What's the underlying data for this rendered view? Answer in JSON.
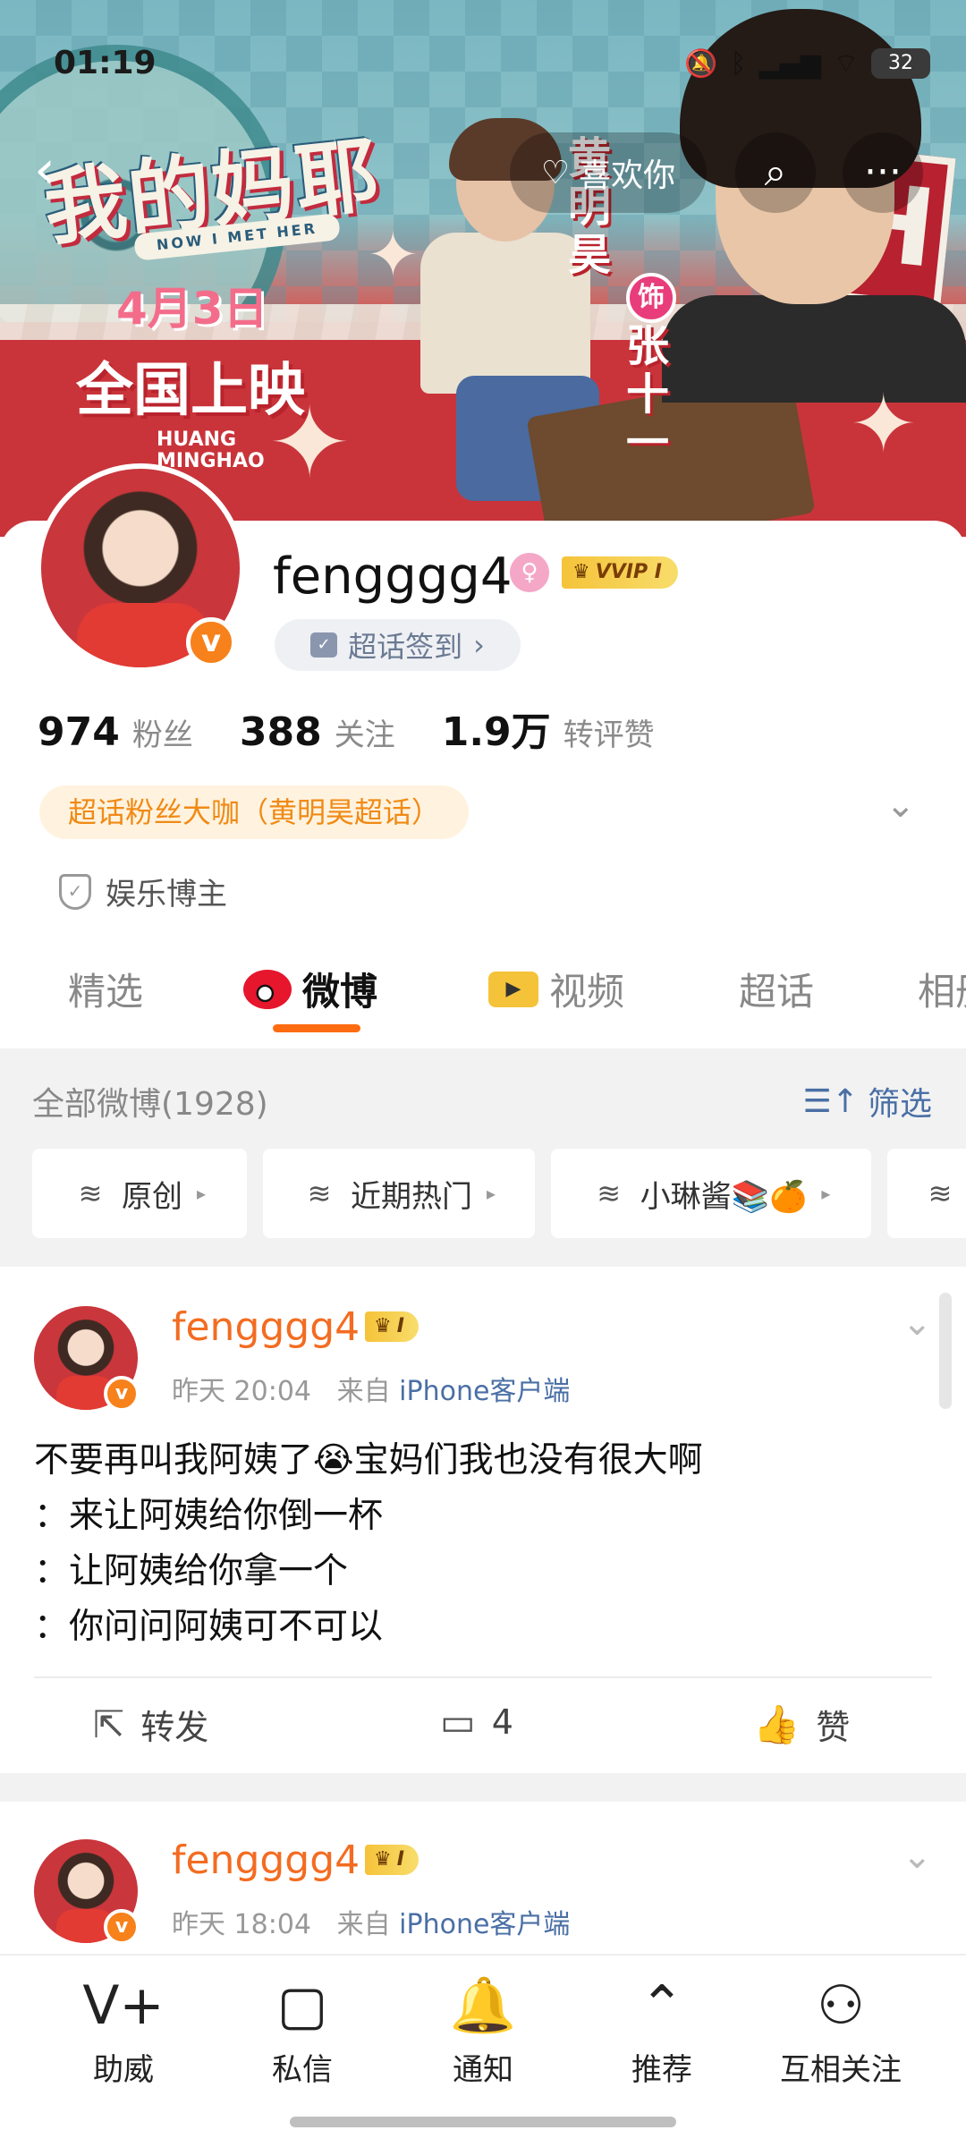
{
  "status_bar": {
    "time": "01:19",
    "battery": "32",
    "icons": [
      "mute-icon",
      "bluetooth-icon",
      "signal-icon",
      "wifi-icon"
    ]
  },
  "banner": {
    "movie_title": "我的妈耶",
    "movie_subtitle": "NOW I MET HER",
    "movie_date": "4月3日",
    "movie_release": "全国上映",
    "actor_name_en_line1": "HUANG",
    "actor_name_en_line2": "MINGHAO",
    "role_actor": "黄明昊",
    "role_badge": "饰",
    "role_character": "张十一",
    "sign_letter": "H"
  },
  "top_nav": {
    "like_label": "喜欢你",
    "icons": [
      "back-icon",
      "search-icon",
      "more-icon"
    ]
  },
  "profile": {
    "username": "fengggg4",
    "vip_label": "VVIP I",
    "checkin_label": "超话签到",
    "stats": [
      {
        "value": "974",
        "label": "粉丝"
      },
      {
        "value": "388",
        "label": "关注"
      },
      {
        "value": "1.9万",
        "label": "转评赞"
      }
    ],
    "fan_badge": "超话粉丝大咖（黄明昊超话）",
    "blogger_tag": "娱乐博主"
  },
  "tabs": [
    {
      "label": "精选",
      "active": false
    },
    {
      "label": "微博",
      "active": true
    },
    {
      "label": "视频",
      "active": false
    },
    {
      "label": "超话",
      "active": false
    },
    {
      "label": "相册",
      "active": false
    }
  ],
  "feed": {
    "title": "全部微博(1928)",
    "filter_label": "筛选",
    "chips": [
      "原创",
      "近期热门",
      "小琳酱📚🍊"
    ]
  },
  "posts": [
    {
      "author": "fengggg4",
      "vip_label": "I",
      "time": "昨天 20:04",
      "from_prefix": "来自",
      "source": "iPhone客户端",
      "lines": [
        "不要再叫我阿姨了😭宝妈们我也没有很大啊",
        "：来让阿姨给你倒一杯",
        "：让阿姨给你拿一个",
        "：你问问阿姨可不可以"
      ],
      "actions": {
        "repost": "转发",
        "comments": "4",
        "like": "赞"
      }
    },
    {
      "author": "fengggg4",
      "vip_label": "I",
      "time": "昨天 18:04",
      "from_prefix": "来自",
      "source": "iPhone客户端"
    }
  ],
  "bottom_nav": [
    {
      "label": "助威",
      "icon": "cheer-icon"
    },
    {
      "label": "私信",
      "icon": "message-icon"
    },
    {
      "label": "通知",
      "icon": "bell-icon"
    },
    {
      "label": "推荐",
      "icon": "recommend-icon"
    },
    {
      "label": "互相关注",
      "icon": "mutual-follow-icon"
    }
  ],
  "colors": {
    "accent_orange": "#fd6c10",
    "name_orange": "#f36c21",
    "link_blue": "#4a6fa5",
    "verify_orange": "#f7811b"
  }
}
